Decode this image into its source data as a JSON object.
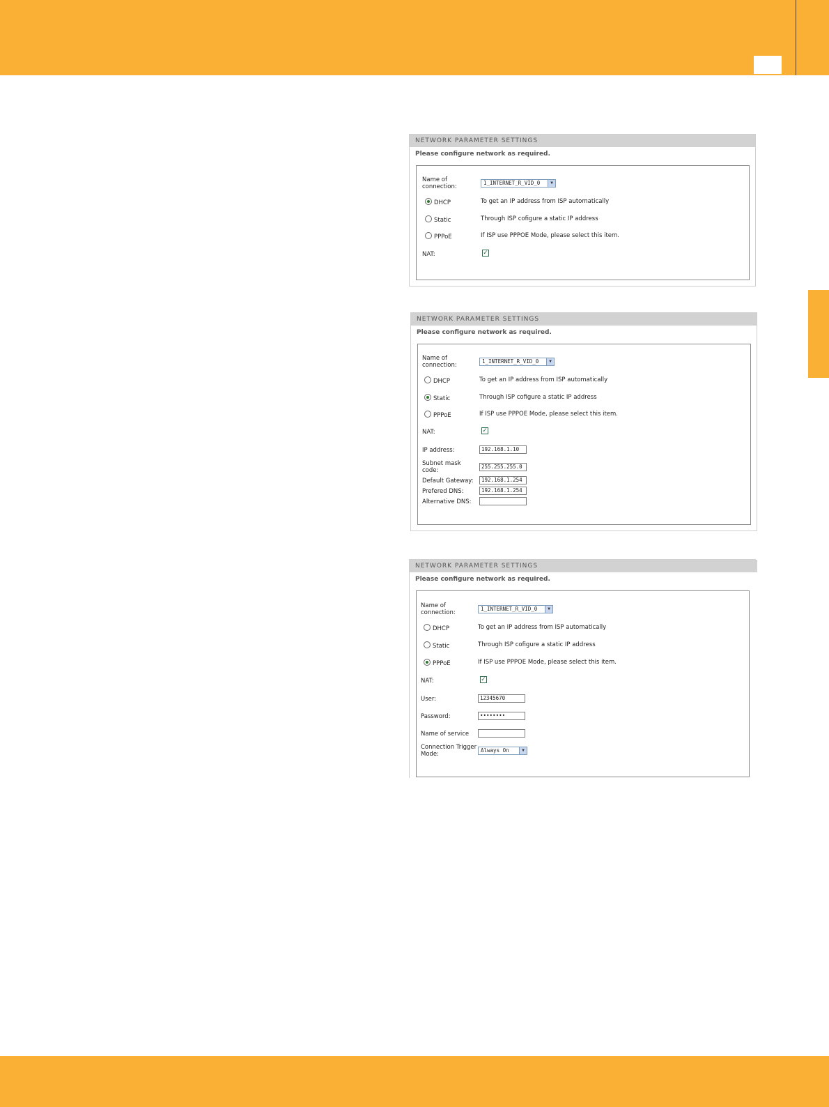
{
  "panels": [
    {
      "header": "NETWORK PARAMETER SETTINGS",
      "subtitle": "Please configure network as required.",
      "name_label": "Name of connection:",
      "connection_value": "1_INTERNET_R_VID_0",
      "options": [
        {
          "label": "DHCP",
          "desc": "To get an IP address from ISP automatically",
          "selected": true
        },
        {
          "label": "Static",
          "desc": "Through ISP cofigure a static IP address",
          "selected": false
        },
        {
          "label": "PPPoE",
          "desc": "If ISP use PPPOE Mode, please select this item.",
          "selected": false
        }
      ],
      "nat_label": "NAT:",
      "nat_checked": true
    },
    {
      "header": "NETWORK PARAMETER SETTINGS",
      "subtitle": "Please configure network as required.",
      "name_label": "Name of connection:",
      "connection_value": "1_INTERNET_R_VID_0",
      "options": [
        {
          "label": "DHCP",
          "desc": "To get an IP address from ISP automatically",
          "selected": false
        },
        {
          "label": "Static",
          "desc": "Through ISP cofigure a static IP address",
          "selected": true
        },
        {
          "label": "PPPoE",
          "desc": "If ISP use PPPOE Mode, please select this item.",
          "selected": false
        }
      ],
      "nat_label": "NAT:",
      "nat_checked": true,
      "fields": [
        {
          "label": "IP address:",
          "value": "192.168.1.10"
        },
        {
          "label": "Subnet mask code:",
          "value": "255.255.255.0"
        },
        {
          "label": "Default Gateway:",
          "value": "192.168.1.254"
        },
        {
          "label": "Prefered DNS:",
          "value": "192.168.1.254"
        },
        {
          "label": "Alternative DNS:",
          "value": ""
        }
      ]
    },
    {
      "header": "NETWORK PARAMETER SETTINGS",
      "subtitle": "Please configure network as required.",
      "name_label": "Name of connection:",
      "connection_value": "1_INTERNET_R_VID_0",
      "options": [
        {
          "label": "DHCP",
          "desc": "To get an IP address from ISP automatically",
          "selected": false
        },
        {
          "label": "Static",
          "desc": "Through ISP cofigure a static IP address",
          "selected": false
        },
        {
          "label": "PPPoE",
          "desc": "If ISP use PPPOE Mode, please select this item.",
          "selected": true
        }
      ],
      "nat_label": "NAT:",
      "nat_checked": true,
      "fields": [
        {
          "label": "User:",
          "value": "12345670"
        },
        {
          "label": "Password:",
          "value": "••••••••"
        },
        {
          "label": "Name of service",
          "value": ""
        }
      ],
      "trigger_label": "Connection Trigger Mode:",
      "trigger_value": "Always On"
    }
  ],
  "colors": {
    "accent": "#f9b035"
  }
}
